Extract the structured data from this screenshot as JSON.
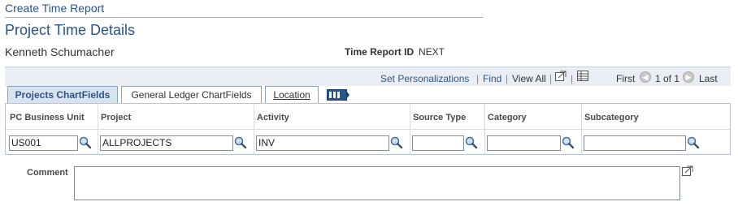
{
  "header": {
    "title": "Create Time Report"
  },
  "page": {
    "title": "Project Time Details",
    "employee_name": "Kenneth Schumacher",
    "time_report_id_label": "Time Report ID",
    "time_report_id_value": "NEXT"
  },
  "grid_nav": {
    "personalize": "Set Personalizations",
    "separator": "|",
    "find": "Find",
    "view_all": "View All",
    "first": "First",
    "range": "1 of 1",
    "last": "Last"
  },
  "tabs": [
    {
      "label": "Projects ChartFields",
      "active": true
    },
    {
      "label": "General Ledger ChartFields",
      "active": false
    },
    {
      "label": "Location",
      "active": false
    }
  ],
  "grid": {
    "columns": [
      "PC Business Unit",
      "Project",
      "Activity",
      "Source Type",
      "Category",
      "Subcategory"
    ],
    "row": {
      "pc_business_unit": "US001",
      "project": "ALLPROJECTS",
      "activity": "INV",
      "source_type": "",
      "category": "",
      "subcategory": ""
    }
  },
  "comment": {
    "label": "Comment",
    "value": ""
  },
  "icons": {
    "lookup": "magnifier-icon",
    "zoom": "zoom-icon",
    "download": "download-grid-icon",
    "prev": "prev-arrow-icon",
    "next": "next-arrow-icon",
    "show_all_columns": "show-all-columns-icon",
    "expand": "expand-icon"
  },
  "colors": {
    "link": "#2a558c",
    "title": "#2a558c",
    "grid_header_bg": "#eaeef4",
    "active_tab_bg": "#d9e3ef"
  }
}
